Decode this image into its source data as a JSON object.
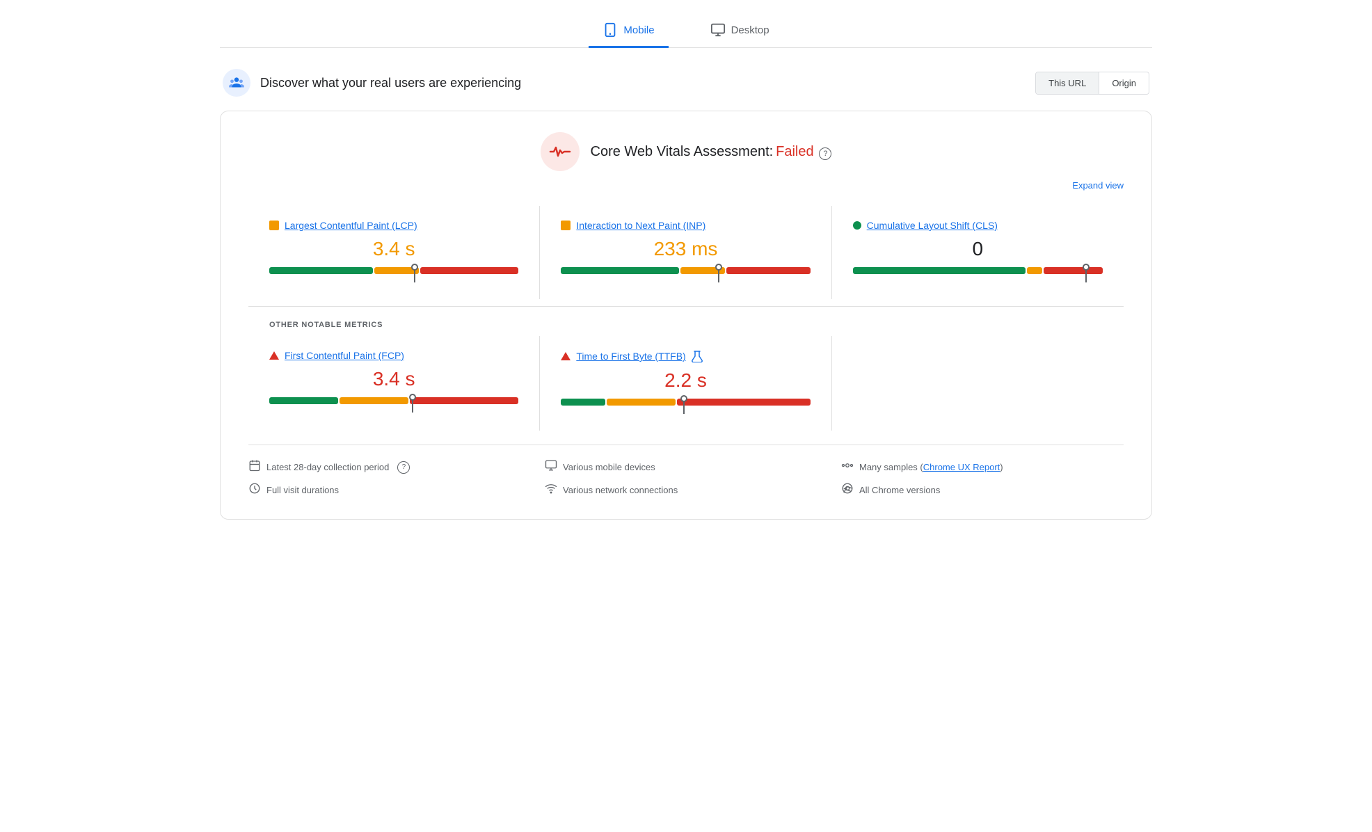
{
  "tabs": [
    {
      "id": "mobile",
      "label": "Mobile",
      "active": true
    },
    {
      "id": "desktop",
      "label": "Desktop",
      "active": false
    }
  ],
  "header": {
    "title": "Discover what your real users are experiencing",
    "url_button": "This URL",
    "origin_button": "Origin"
  },
  "assessment": {
    "title": "Core Web Vitals Assessment:",
    "status": "Failed",
    "expand_label": "Expand view"
  },
  "metrics": [
    {
      "id": "lcp",
      "name": "Largest Contentful Paint (LCP)",
      "indicator": "orange-square",
      "value": "3.4 s",
      "value_color": "orange",
      "bar": {
        "green": 42,
        "orange": 18,
        "red": 40,
        "marker_pct": 57
      }
    },
    {
      "id": "inp",
      "name": "Interaction to Next Paint (INP)",
      "indicator": "orange-square",
      "value": "233 ms",
      "value_color": "orange",
      "bar": {
        "green": 48,
        "orange": 18,
        "red": 34,
        "marker_pct": 62
      }
    },
    {
      "id": "cls",
      "name": "Cumulative Layout Shift (CLS)",
      "indicator": "green-circle",
      "value": "0",
      "value_color": "black",
      "bar": {
        "green": 70,
        "orange": 6,
        "red": 24,
        "marker_pct": 92
      }
    }
  ],
  "other_metrics_label": "OTHER NOTABLE METRICS",
  "other_metrics": [
    {
      "id": "fcp",
      "name": "First Contentful Paint (FCP)",
      "indicator": "red-triangle",
      "value": "3.4 s",
      "value_color": "red",
      "bar": {
        "green": 28,
        "orange": 28,
        "red": 44,
        "marker_pct": 56
      }
    },
    {
      "id": "ttfb",
      "name": "Time to First Byte (TTFB)",
      "indicator": "red-triangle",
      "has_beaker": true,
      "value": "2.2 s",
      "value_color": "red",
      "bar": {
        "green": 18,
        "orange": 28,
        "red": 54,
        "marker_pct": 48
      }
    }
  ],
  "footer": [
    {
      "icon": "calendar",
      "text": "Latest 28-day collection period",
      "has_help": true
    },
    {
      "icon": "monitor",
      "text": "Various mobile devices"
    },
    {
      "icon": "dots",
      "text": "Many samples",
      "link": "Chrome UX Report"
    },
    {
      "icon": "clock",
      "text": "Full visit durations"
    },
    {
      "icon": "wifi",
      "text": "Various network connections"
    },
    {
      "icon": "chrome",
      "text": "All Chrome versions"
    }
  ]
}
